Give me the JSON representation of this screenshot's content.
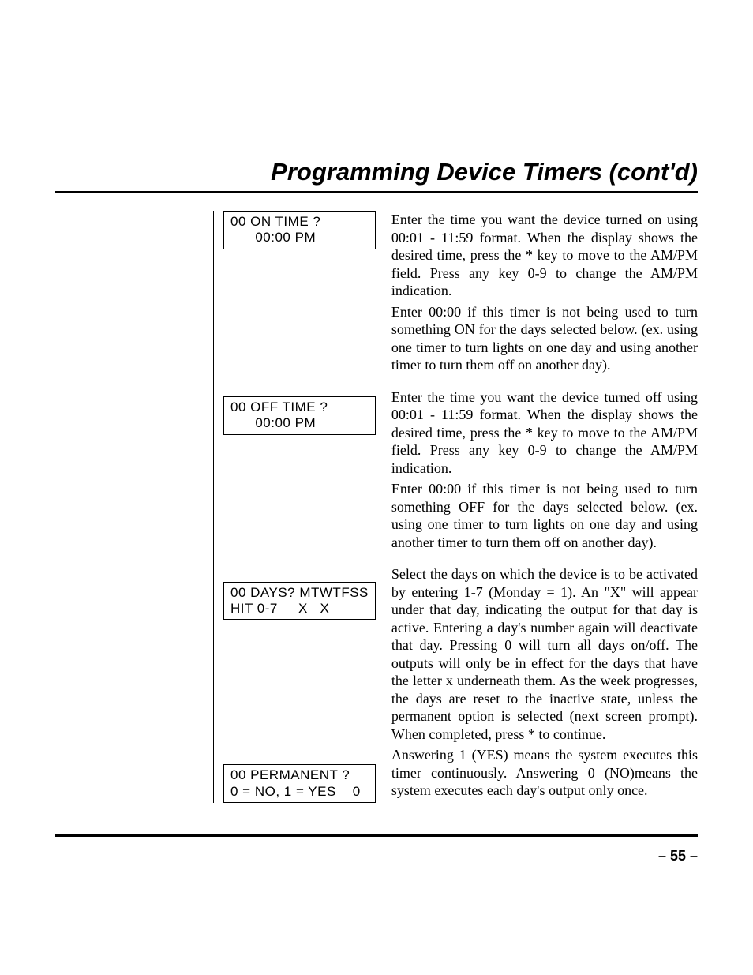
{
  "title": "Programming Device Timers (cont'd)",
  "sections": [
    {
      "lcd": "00 ON TIME ?\n      00:00 PM",
      "paras": [
        "Enter the time you want the device turned on using 00:01 - 11:59 format. When the display shows the desired time, press the * key to move to the AM/PM field. Press any key 0-9 to change the AM/PM indication.",
        "Enter 00:00 if this timer is not being used to turn something ON for the days selected below. (ex. using one timer to turn lights on one day and using another timer to turn them off on another day)."
      ]
    },
    {
      "lcd": "00 OFF TIME ?\n      00:00 PM",
      "paras": [
        "Enter the time you want the device turned off using 00:01 - 11:59 format. When the display shows the desired time, press the * key to move to the AM/PM field. Press any key 0-9 to change the AM/PM indication.",
        "Enter 00:00 if this timer is not being used to turn something OFF for the days selected below. (ex. using one timer to turn lights on one day and using another timer to turn them off on another day)."
      ]
    },
    {
      "lcd": "00 DAYS? MTWTFSS\nHIT 0-7     X   X",
      "paras": [
        "Select the days on which the device is to be activated by entering 1-7 (Monday = 1). An \"X\" will appear under that day, indicating the output for that day is active. Entering a day's number again will deactivate that day. Pressing 0 will turn all days on/off. The outputs will only be in effect for the days  that have the letter x underneath them. As the week progresses, the days are reset to the inactive state, unless the permanent option is selected (next screen prompt). When completed, press * to continue."
      ]
    },
    {
      "lcd": "00 PERMANENT ?\n0 = NO, 1 = YES    0",
      "paras": [
        "Answering 1 (YES) means the system executes this timer continuously. Answering  0 (NO)means the system executes each day's output only once."
      ]
    }
  ],
  "page_number": "– 55 –"
}
